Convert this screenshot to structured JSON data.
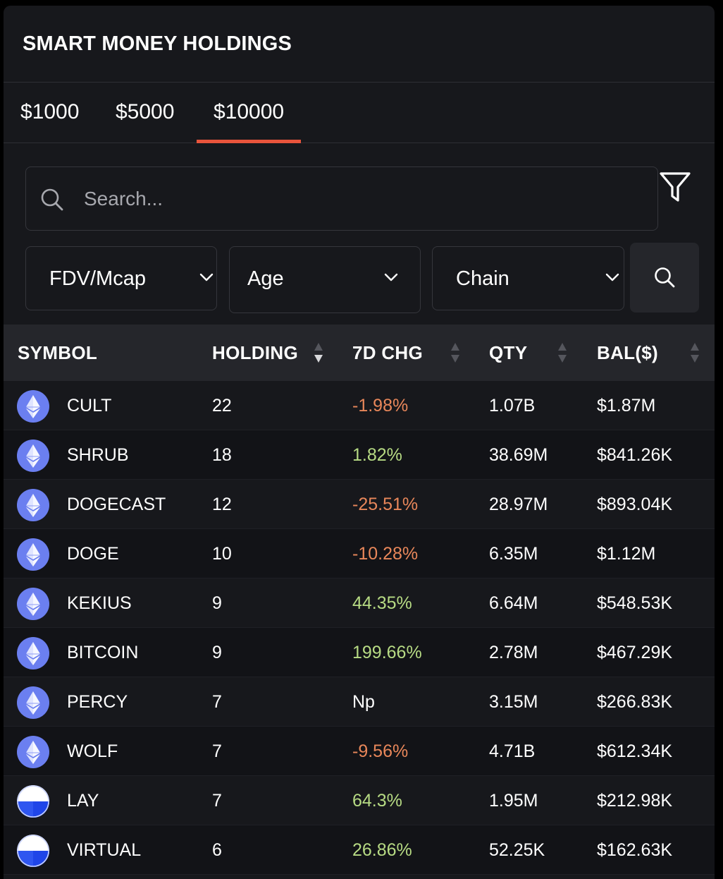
{
  "title": "SMART MONEY HOLDINGS",
  "tabs": [
    {
      "label": "$1000",
      "active": false
    },
    {
      "label": "$5000",
      "active": false
    },
    {
      "label": "$10000",
      "active": true
    }
  ],
  "accent_color": "#e8543c",
  "search": {
    "placeholder": "Search...",
    "value": ""
  },
  "filters": {
    "fdv_label": "FDV/Mcap",
    "age_label": "Age",
    "chain_label": "Chain"
  },
  "table": {
    "headers": {
      "symbol": "SYMBOL",
      "holding": "HOLDING",
      "chg": "7D CHG",
      "qty": "QTY",
      "bal": "BAL($)"
    },
    "rows": [
      {
        "icon": "ethereum-icon",
        "symbol": "CULT",
        "holding": "22",
        "chg": "-1.98%",
        "trend": "neg",
        "qty": "1.07B",
        "bal": "$1.87M"
      },
      {
        "icon": "ethereum-icon",
        "symbol": "SHRUB",
        "holding": "18",
        "chg": "1.82%",
        "trend": "pos",
        "qty": "38.69M",
        "bal": "$841.26K"
      },
      {
        "icon": "ethereum-icon",
        "symbol": "DOGECAST",
        "holding": "12",
        "chg": "-25.51%",
        "trend": "neg",
        "qty": "28.97M",
        "bal": "$893.04K"
      },
      {
        "icon": "ethereum-icon",
        "symbol": "DOGE",
        "holding": "10",
        "chg": "-10.28%",
        "trend": "neg",
        "qty": "6.35M",
        "bal": "$1.12M"
      },
      {
        "icon": "ethereum-icon",
        "symbol": "KEKIUS",
        "holding": "9",
        "chg": "44.35%",
        "trend": "pos",
        "qty": "6.64M",
        "bal": "$548.53K"
      },
      {
        "icon": "ethereum-icon",
        "symbol": "BITCOIN",
        "holding": "9",
        "chg": "199.66%",
        "trend": "pos",
        "qty": "2.78M",
        "bal": "$467.29K"
      },
      {
        "icon": "ethereum-icon",
        "symbol": "PERCY",
        "holding": "7",
        "chg": "Np",
        "trend": "neu",
        "qty": "3.15M",
        "bal": "$266.83K"
      },
      {
        "icon": "ethereum-icon",
        "symbol": "WOLF",
        "holding": "7",
        "chg": "-9.56%",
        "trend": "neg",
        "qty": "4.71B",
        "bal": "$612.34K"
      },
      {
        "icon": "base-icon",
        "symbol": "LAY",
        "holding": "7",
        "chg": "64.3%",
        "trend": "pos",
        "qty": "1.95M",
        "bal": "$212.98K"
      },
      {
        "icon": "base-icon",
        "symbol": "VIRTUAL",
        "holding": "6",
        "chg": "26.86%",
        "trend": "pos",
        "qty": "52.25K",
        "bal": "$162.63K"
      }
    ]
  }
}
